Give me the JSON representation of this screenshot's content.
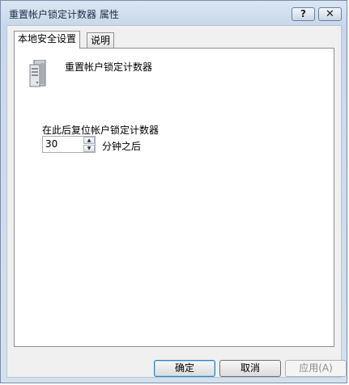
{
  "window": {
    "title": "重置帐户锁定计数器 属性",
    "help_label": "?",
    "close_label": "✕"
  },
  "tabs": [
    {
      "label": "本地安全设置",
      "active": true
    },
    {
      "label": "说明",
      "active": false
    }
  ],
  "policy": {
    "icon": "server-icon",
    "title": "重置帐户锁定计数器"
  },
  "field": {
    "label": "在此后复位帐户锁定计数器",
    "value": "30",
    "unit": "分钟之后"
  },
  "buttons": {
    "ok": "确定",
    "cancel": "取消",
    "apply": "应用(A)"
  }
}
